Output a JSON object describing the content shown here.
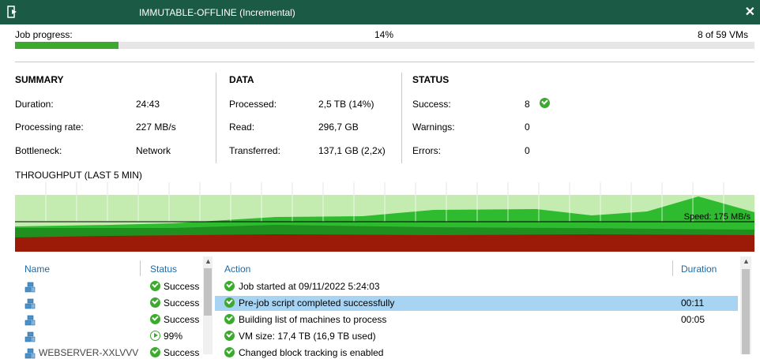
{
  "window": {
    "title": "IMMUTABLE-OFFLINE (Incremental)",
    "close_label": "✕"
  },
  "progress": {
    "label": "Job progress:",
    "percent_text": "14%",
    "percent": 14,
    "vm_count": "8 of 59 VMs"
  },
  "summary": {
    "heading": "SUMMARY",
    "rows": [
      {
        "label": "Duration:",
        "value": "24:43"
      },
      {
        "label": "Processing rate:",
        "value": "227 MB/s"
      },
      {
        "label": "Bottleneck:",
        "value": "Network"
      }
    ]
  },
  "data": {
    "heading": "DATA",
    "rows": [
      {
        "label": "Processed:",
        "value": "2,5 TB (14%)"
      },
      {
        "label": "Read:",
        "value": "296,7 GB"
      },
      {
        "label": "Transferred:",
        "value": "137,1 GB (2,2x)"
      }
    ]
  },
  "status": {
    "heading": "STATUS",
    "rows": [
      {
        "label": "Success:",
        "value": "8"
      },
      {
        "label": "Warnings:",
        "value": "0"
      },
      {
        "label": "Errors:",
        "value": "0"
      }
    ]
  },
  "throughput": {
    "heading": "THROUGHPUT (LAST 5 MIN)",
    "speed_label": "Speed: 175 MB/s",
    "colors": {
      "background": "#c4ecb0",
      "read": "#2fbb2f",
      "processed": "#1f8f1f",
      "transferred": "#9c1a08",
      "grid": "#ffffff"
    }
  },
  "vm_list": {
    "headers": {
      "name": "Name",
      "status": "Status"
    },
    "rows": [
      {
        "name": "",
        "status": "Success",
        "state": "ok"
      },
      {
        "name": "",
        "status": "Success",
        "state": "ok"
      },
      {
        "name": "",
        "status": "Success",
        "state": "ok"
      },
      {
        "name": "",
        "status": "99%",
        "state": "running"
      },
      {
        "name": "WEBSERVER-XXLVVV",
        "status": "Success",
        "state": "ok"
      }
    ]
  },
  "actions": {
    "headers": {
      "action": "Action",
      "duration": "Duration"
    },
    "rows": [
      {
        "text": "Job started at 09/11/2022 5:24:03",
        "duration": ""
      },
      {
        "text": "Pre-job script completed successfully",
        "duration": "00:11"
      },
      {
        "text": "Building list of machines to process",
        "duration": "00:05"
      },
      {
        "text": "VM size: 17,4 TB (16,9 TB used)",
        "duration": ""
      },
      {
        "text": "Changed block tracking is enabled",
        "duration": ""
      }
    ]
  }
}
